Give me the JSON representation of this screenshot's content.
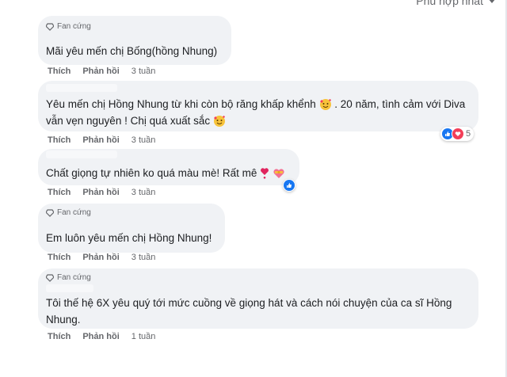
{
  "sort": {
    "label": "Phù hợp nhất"
  },
  "comments": [
    {
      "badge": "Fan cứng",
      "text": "Mãi yêu mến chị Bống(hồng Nhung)",
      "actions": {
        "like": "Thích",
        "reply": "Phản hồi",
        "time": "3 tuần"
      }
    },
    {
      "badge": "",
      "text_1": "Yêu mến chị Hồng Nhung từ khi còn bộ răng khấp khểnh",
      "text_2": ". 20 năm, tình cảm với Diva",
      "text_3": "vẫn vẹn nguyên ! Chị quá xuất sắc",
      "reaction_count": "5",
      "actions": {
        "like": "Thích",
        "reply": "Phản hồi",
        "time": "3 tuần"
      }
    },
    {
      "badge": "",
      "text": "Chất giọng tự nhiên ko quá màu mè! Rất mê",
      "actions": {
        "like": "Thích",
        "reply": "Phản hồi",
        "time": "3 tuần"
      }
    },
    {
      "badge": "Fan cứng",
      "text": "Em luôn yêu mến chị Hồng Nhung!",
      "actions": {
        "like": "Thích",
        "reply": "Phản hồi",
        "time": "3 tuần"
      }
    },
    {
      "badge": "Fan cứng",
      "text_1": "Tôi thế hệ 6X yêu quý tới mức cuồng về giọng hát và cách nói chuyện của ca sĩ Hồng",
      "text_2": "Nhung.",
      "actions": {
        "like": "Thích",
        "reply": "Phản hồi",
        "time": "1 tuần"
      }
    }
  ]
}
